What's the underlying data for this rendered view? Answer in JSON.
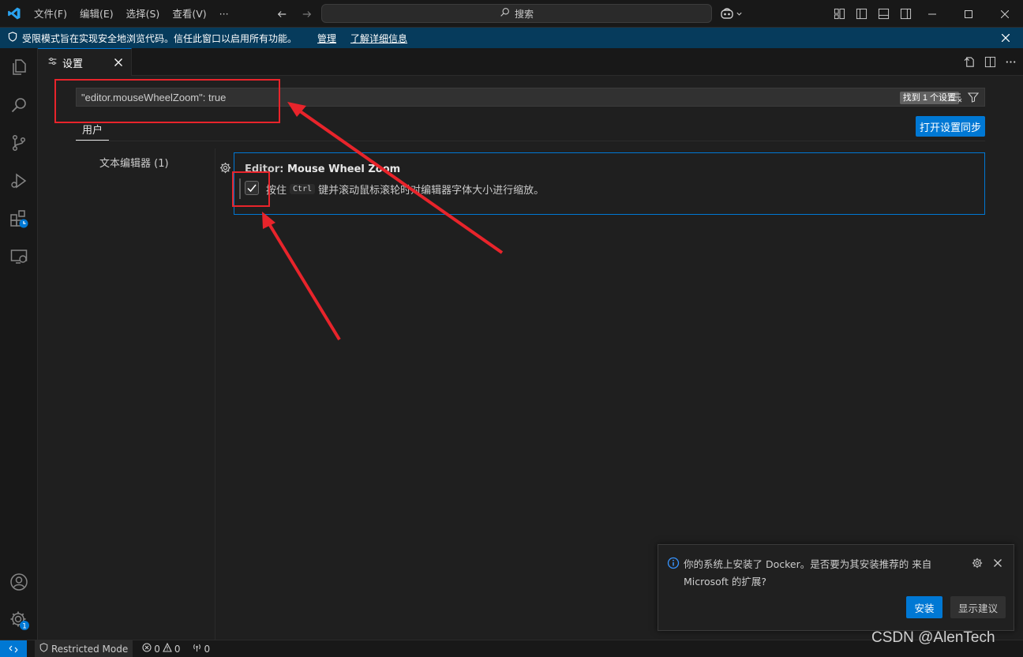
{
  "menu": [
    "文件(F)",
    "编辑(E)",
    "选择(S)",
    "查看(V)",
    "···"
  ],
  "command_center": {
    "label": "搜索"
  },
  "banner": {
    "message": "受限模式旨在实现安全地浏览代码。信任此窗口以启用所有功能。",
    "manage": "管理",
    "learn_more": "了解详细信息"
  },
  "tab": {
    "label": "设置"
  },
  "settings": {
    "search_value": "\"editor.mouseWheelZoom\": true",
    "found_badge": "找到 1 个设置",
    "scope_tab": "用户",
    "sync_button": "打开设置同步",
    "toc_item": "文本编辑器 (1)",
    "setting": {
      "category": "Editor: ",
      "name": "Mouse Wheel Zoom",
      "checked": true,
      "desc_before": "按住",
      "desc_key": "Ctrl",
      "desc_after": "键并滚动鼠标滚轮时对编辑器字体大小进行缩放。"
    }
  },
  "activity_badge": "1",
  "notification": {
    "line1": "你的系统上安装了 Docker。是否要为其安装推荐的 来自",
    "line2": "Microsoft 的扩展?",
    "primary": "安装",
    "secondary": "显示建议"
  },
  "statusbar": {
    "restricted": "Restricted Mode",
    "errors": "0",
    "warnings": "0",
    "ports": "0"
  },
  "watermark": "CSDN @AlenTech",
  "colors": {
    "accent": "#0078d4",
    "annotation": "#e8242b",
    "banner": "#063b5c"
  }
}
